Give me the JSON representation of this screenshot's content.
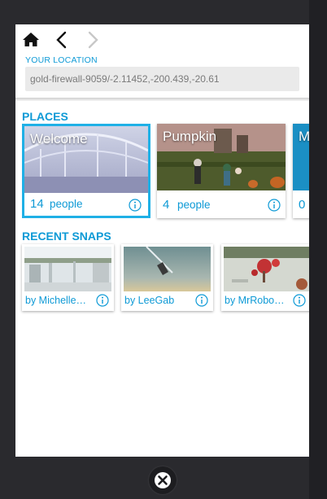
{
  "nav": {
    "home_icon": "home-icon",
    "back_icon": "chevron-left-icon",
    "forward_icon": "chevron-right-icon"
  },
  "location": {
    "label": "YOUR LOCATION",
    "value": "gold-firewall-9059/-2.11452,-200.439,-20.61"
  },
  "places": {
    "title": "PLACES",
    "items": [
      {
        "name": "Welcome",
        "count": "14",
        "unit": "people",
        "selected": true
      },
      {
        "name": "Pumpkin",
        "count": "4",
        "unit": "people",
        "selected": false
      },
      {
        "name": "M",
        "count": "0",
        "unit": "",
        "selected": false
      }
    ]
  },
  "snaps": {
    "title": "RECENT SNAPS",
    "items": [
      {
        "by": "by Michelle…"
      },
      {
        "by": "by LeeGab"
      },
      {
        "by": "by MrRobo…"
      }
    ]
  },
  "colors": {
    "accent": "#0e9ad6",
    "selected_border": "#1fb0e6"
  },
  "close_icon": "close-icon"
}
